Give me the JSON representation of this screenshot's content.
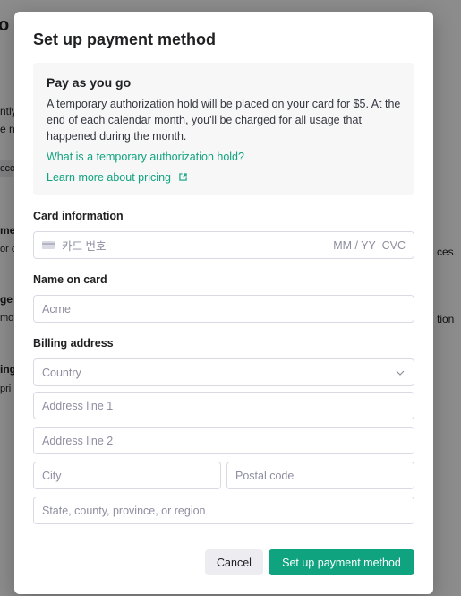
{
  "background": {
    "title": "o",
    "fragments": [
      "ntly",
      "e n",
      "cco",
      "me",
      "or c",
      "ces",
      "ge",
      "mor",
      "tion",
      "ing",
      "pri"
    ]
  },
  "modal": {
    "title": "Set up payment method",
    "info": {
      "heading": "Pay as you go",
      "body": "A temporary authorization hold will be placed on your card for $5. At the end of each calendar month, you'll be charged for all usage that happened during the month.",
      "link_hold": "What is a temporary authorization hold?",
      "link_pricing": "Learn more about pricing"
    },
    "card": {
      "label": "Card information",
      "number_placeholder": "카드 번호",
      "expiry_cvc": "MM / YY  CVC"
    },
    "name": {
      "label": "Name on card",
      "placeholder": "Acme"
    },
    "billing": {
      "label": "Billing address",
      "country_placeholder": "Country",
      "address1_placeholder": "Address line 1",
      "address2_placeholder": "Address line 2",
      "city_placeholder": "City",
      "postal_placeholder": "Postal code",
      "state_placeholder": "State, county, province, or region"
    },
    "buttons": {
      "cancel": "Cancel",
      "submit": "Set up payment method"
    }
  },
  "colors": {
    "accent": "#10a37f",
    "overlay": "rgba(0,0,0,0.45)",
    "info_bg": "#f7f7f8",
    "border": "#d9d9e3"
  },
  "icons": {
    "external_link": "external-link-icon",
    "card": "credit-card-icon",
    "chevron": "chevron-down-icon"
  }
}
